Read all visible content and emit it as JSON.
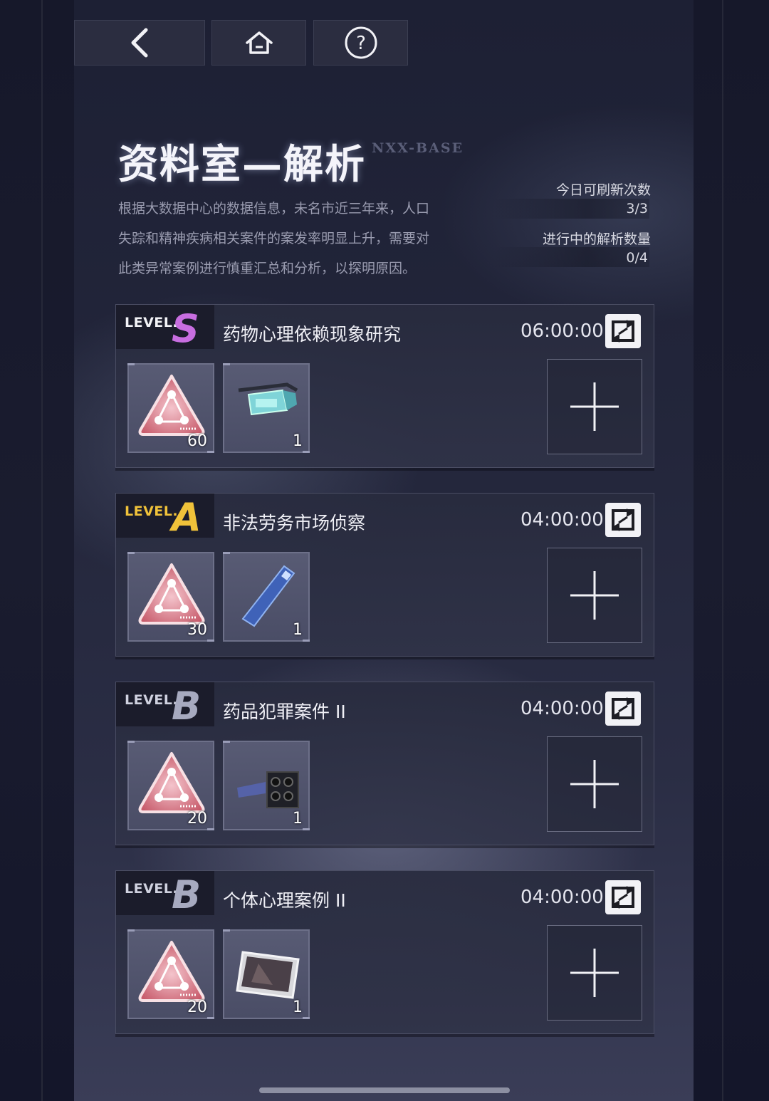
{
  "nav": {
    "back_icon": "chevron-left-icon",
    "home_icon": "home-icon",
    "help_icon": "question-circle-icon"
  },
  "header": {
    "title": "资料室—解析",
    "code": "NXX-BASE",
    "description": [
      "根据大数据中心的数据信息，未名市近三年来，人口",
      "失踪和精神疾病相关案件的案发率明显上升，需要对",
      "此类异常案例进行慎重汇总和分析，以探明原因。"
    ]
  },
  "stats": {
    "refresh_label": "今日可刷新次数",
    "refresh_value": "3/3",
    "analysis_label": "进行中的解析数量",
    "analysis_value": "0/4"
  },
  "cases": [
    {
      "level_word": "LEVEL.",
      "level": "S",
      "title": "药物心理依赖现象研究",
      "time": "06:00:00",
      "items": [
        {
          "icon": "triangle-token-icon",
          "count": "60"
        },
        {
          "icon": "data-glasses-icon",
          "count": "1"
        }
      ]
    },
    {
      "level_word": "LEVEL.",
      "level": "A",
      "title": "非法劳务市场侦察",
      "time": "04:00:00",
      "items": [
        {
          "icon": "triangle-token-icon",
          "count": "30"
        },
        {
          "icon": "recorder-pen-icon",
          "count": "1"
        }
      ]
    },
    {
      "level_word": "LEVEL.",
      "level": "B",
      "title": "药品犯罪案件 II",
      "time": "04:00:00",
      "items": [
        {
          "icon": "triangle-token-icon",
          "count": "20"
        },
        {
          "icon": "building-block-icon",
          "count": "1"
        }
      ]
    },
    {
      "level_word": "LEVEL.",
      "level": "B",
      "title": "个体心理案例 II",
      "time": "04:00:00",
      "items": [
        {
          "icon": "triangle-token-icon",
          "count": "20"
        },
        {
          "icon": "phone-device-icon",
          "count": "1"
        }
      ]
    }
  ],
  "colors": {
    "level_S": "#c86ee0",
    "level_A": "#f0c23a",
    "level_B": "#a7aac0"
  }
}
